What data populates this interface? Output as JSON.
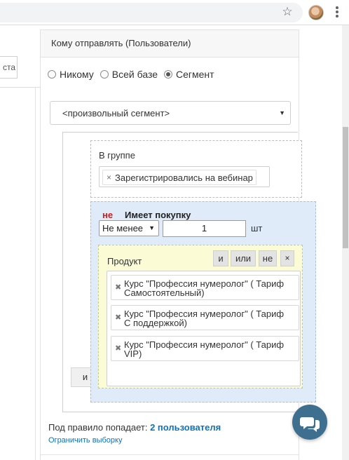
{
  "browser": {
    "icons": [
      "star-icon",
      "avatar",
      "menu-icon"
    ]
  },
  "left": {
    "input_text": "ста"
  },
  "panel": {
    "header": "Кому отправлять (Пользователи)",
    "radios": [
      {
        "label": "Никому",
        "checked": false
      },
      {
        "label": "Всей базе",
        "checked": false
      },
      {
        "label": "Сегмент",
        "checked": true
      }
    ],
    "segment_select": "<произвольный сегмент>",
    "and_button": "и",
    "group": {
      "label": "В группе",
      "tag": "Зарегистрировались на вебинар"
    },
    "purchase": {
      "not_label": "не",
      "title": "Имеет покупку",
      "min_select": "Не менее",
      "quantity": "1",
      "unit": "шт"
    },
    "product": {
      "label": "Продукт",
      "ops": {
        "and": "и",
        "or": "или",
        "not": "не",
        "remove": "×"
      },
      "items": [
        {
          "line1": "Курс \"Профессия нумеролог\" ( Тариф",
          "line2": "Самостоятельный)"
        },
        {
          "line1": "Курс \"Профессия нумеролог\" ( Тариф",
          "line2": "С поддержкой)"
        },
        {
          "line1": "Курс \"Профессия нумеролог\" ( Тариф",
          "line2": "VIP)"
        }
      ]
    },
    "result_prefix": "Под правило попадает:",
    "result_count": "2 пользователя",
    "limit_link": "Ограничить выборку"
  },
  "colors": {
    "accent": "#0f72b8",
    "not_red": "#d11b1b",
    "purchase_bg": "#dfebf9",
    "product_bg": "#fbfbd6",
    "chat_button": "#3f6f8e"
  }
}
